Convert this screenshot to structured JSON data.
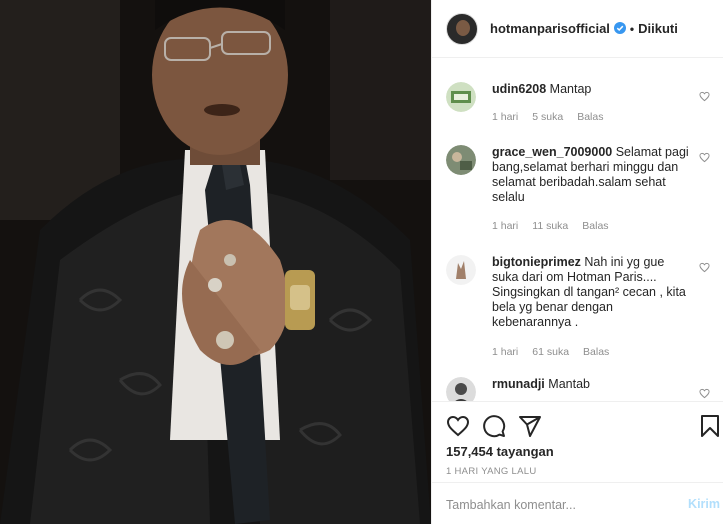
{
  "post": {
    "username": "hotmanparisofficial",
    "separator": "•",
    "follow_status": "Diikuti"
  },
  "comments": [
    {
      "username": "udin6208",
      "text": "Mantap",
      "time": "1 hari",
      "likes": "5 suka",
      "reply": "Balas"
    },
    {
      "username": "grace_wen_7009000",
      "text": "Selamat pagi bang,selamat berhari minggu dan selamat beribadah.salam sehat selalu",
      "time": "1 hari",
      "likes": "11 suka",
      "reply": "Balas"
    },
    {
      "username": "bigtonieprimez",
      "text": "Nah ini yg gue suka dari om Hotman Paris.... Singsingkan dl tangan² cecan , kita bela yg benar dengan kebenarannya .",
      "time": "1 hari",
      "likes": "61 suka",
      "reply": "Balas"
    },
    {
      "username": "rmunadji",
      "text": "Mantab"
    }
  ],
  "footer": {
    "views": "157,454 tayangan",
    "posted": "1 HARI YANG LALU",
    "comment_placeholder": "Tambahkan komentar...",
    "send_label": "Kirim"
  },
  "icons": {
    "like": "heart-icon",
    "comment": "comment-icon",
    "share": "share-icon",
    "save": "bookmark-icon",
    "verified": "verified-badge-icon",
    "comment_like": "small-heart-icon"
  },
  "colors": {
    "verified": "#3897f0",
    "send_disabled": "#b2dffc",
    "secondary_text": "#8e8e8e"
  }
}
